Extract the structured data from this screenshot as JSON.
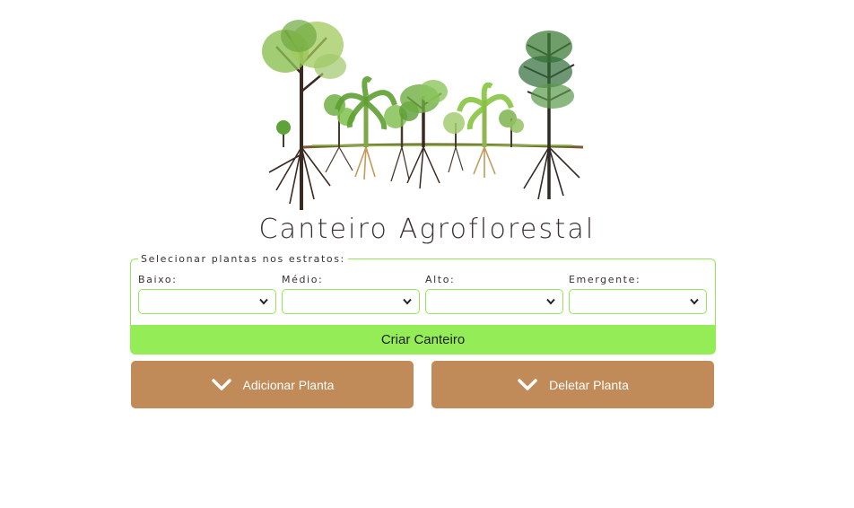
{
  "header": {
    "title": "Canteiro Agroflorestal"
  },
  "selection": {
    "legend": "Selecionar plantas nos estratos:",
    "strata": [
      {
        "label": "Baixo:",
        "selected": ""
      },
      {
        "label": "Médio:",
        "selected": ""
      },
      {
        "label": "Alto:",
        "selected": ""
      },
      {
        "label": "Emergente:",
        "selected": ""
      }
    ],
    "create_label": "Criar Canteiro"
  },
  "actions": {
    "add_label": "Adicionar Planta",
    "delete_label": "Deletar Planta",
    "icon": "chevron-down-icon"
  },
  "colors": {
    "accent_green": "#94ec57",
    "action_brown": "#c08b58",
    "title_text": "#3a3030"
  }
}
